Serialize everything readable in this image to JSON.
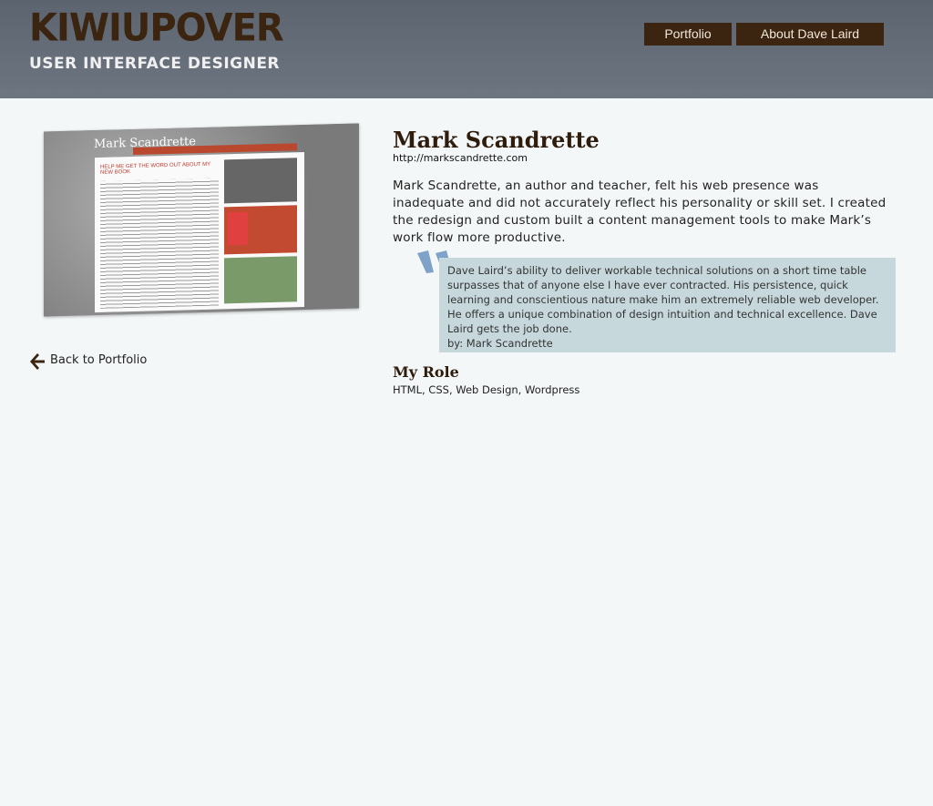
{
  "header": {
    "logo_title": "KIWIUPOVER",
    "logo_subtitle": "USER INTERFACE DESIGNER",
    "nav": {
      "portfolio": "Portfolio",
      "about": "About Dave Laird"
    }
  },
  "thumbnail": {
    "site_title": "Mark Scandrette",
    "headline": "HELP ME GET THE WORD OUT ABOUT MY NEW BOOK"
  },
  "back_link": {
    "label": "Back to Portfolio",
    "icon": "arrow-left-icon"
  },
  "project": {
    "title": "Mark Scandrette",
    "url": "http://markscandrette.com",
    "description": "Mark Scandrette, an author and teacher, felt his web presence was inadequate and did not accurately reflect his personality or skill set.  I created the redesign and custom built a content management tools to make Mark’s work flow more productive."
  },
  "testimonial": {
    "text": "Dave Laird’s ability to deliver workable technical solutions on a short time table surpasses that of anyone else I have ever contracted. His persistence, quick learning and conscientious nature make him an extremely reliable web developer. He offers a unique combination of design intuition and technical excellence. Dave Laird gets the job done.",
    "byline": "by: Mark Scandrette"
  },
  "role": {
    "heading": "My Role",
    "items": "HTML, CSS, Web Design, Wordpress"
  },
  "colors": {
    "header_bg": "#666e7a",
    "nav_bg": "#3b2510",
    "quote_bg": "#c7d8dc",
    "page_bg": "#f4f7f8",
    "quote_mark": "#6a93bf"
  }
}
